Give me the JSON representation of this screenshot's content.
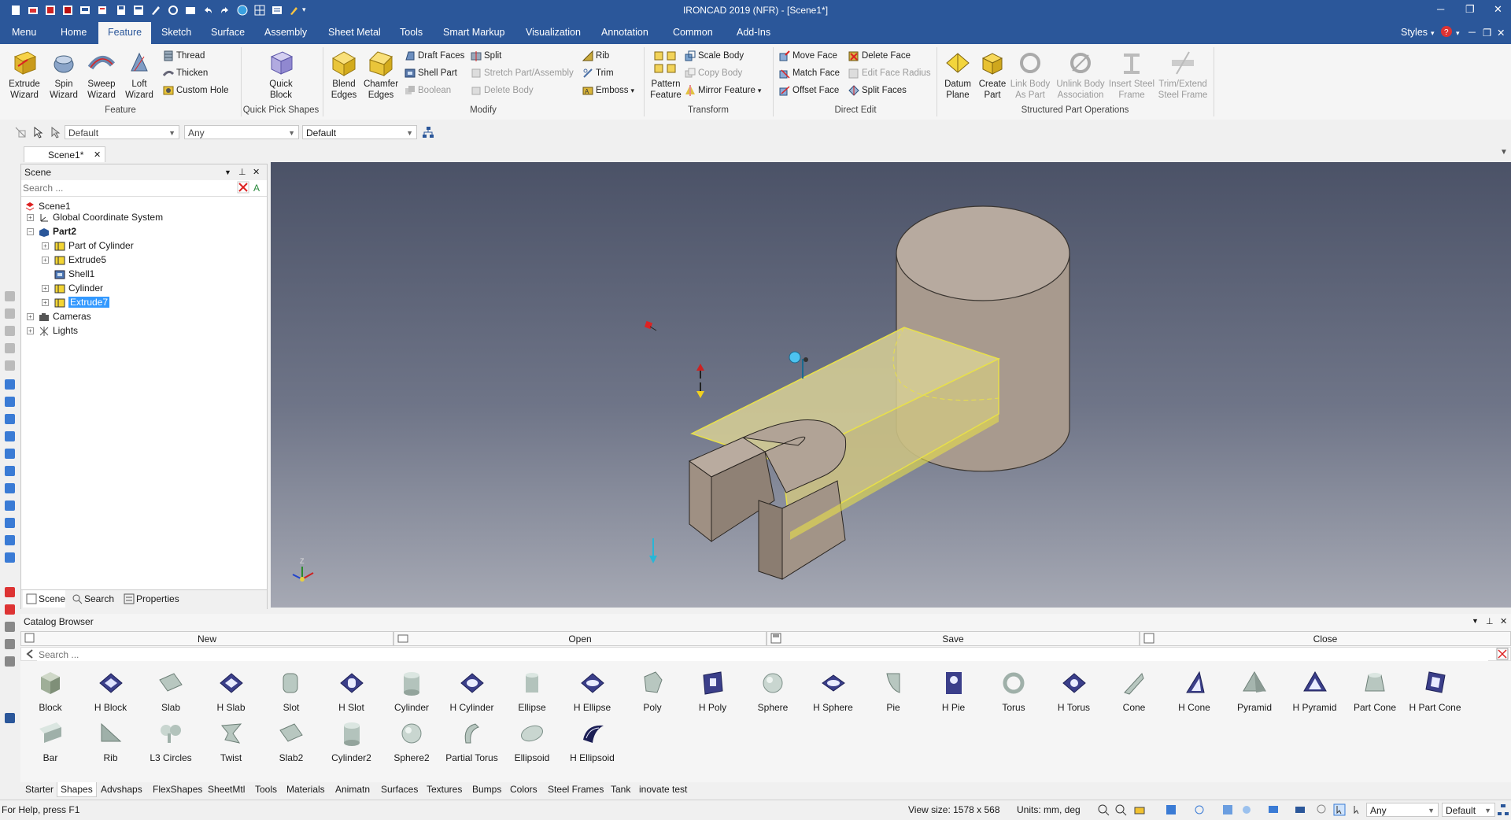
{
  "app": {
    "title": "IRONCAD 2019 (NFR) - [Scene1*]",
    "styles_label": "Styles",
    "window_controls": [
      "minimize-icon",
      "restore-icon",
      "close-icon"
    ]
  },
  "menu_tabs": [
    {
      "label": "Menu",
      "active": false
    },
    {
      "label": "Home",
      "active": false
    },
    {
      "label": "Feature",
      "active": true
    },
    {
      "label": "Sketch",
      "active": false
    },
    {
      "label": "Surface",
      "active": false
    },
    {
      "label": "Assembly",
      "active": false
    },
    {
      "label": "Sheet Metal",
      "active": false
    },
    {
      "label": "Tools",
      "active": false
    },
    {
      "label": "Smart Markup",
      "active": false
    },
    {
      "label": "Visualization",
      "active": false
    },
    {
      "label": "Annotation",
      "active": false
    },
    {
      "label": "Common",
      "active": false
    },
    {
      "label": "Add-Ins",
      "active": false
    }
  ],
  "ribbon": {
    "feature": {
      "group_label": "Feature",
      "extrude": "Extrude Wizard",
      "spin": "Spin Wizard",
      "sweep": "Sweep Wizard",
      "loft": "Loft Wizard",
      "thread": "Thread",
      "thicken": "Thicken",
      "custom_hole": "Custom Hole"
    },
    "quick_pick": {
      "group_label": "Quick Pick Shapes",
      "quick_block": "Quick Block"
    },
    "modify": {
      "group_label": "Modify",
      "blend_edges": "Blend Edges",
      "chamfer_edges": "Chamfer Edges",
      "draft_faces": "Draft Faces",
      "shell_part": "Shell Part",
      "boolean": "Boolean",
      "split": "Split",
      "stretch": "Stretch Part/Assembly",
      "delete_body": "Delete Body",
      "rib": "Rib",
      "trim": "Trim",
      "emboss": "Emboss"
    },
    "transform": {
      "group_label": "Transform",
      "pattern": "Pattern Feature",
      "scale_body": "Scale Body",
      "copy_body": "Copy Body",
      "mirror": "Mirror Feature"
    },
    "direct_edit": {
      "group_label": "Direct Edit",
      "move_face": "Move Face",
      "match_face": "Match Face",
      "offset_face": "Offset Face",
      "delete_face": "Delete Face",
      "edit_face_radius": "Edit Face Radius",
      "split_faces": "Split Faces"
    },
    "structured": {
      "group_label": "Structured Part Operations",
      "datum_plane": "Datum Plane",
      "create_part": "Create Part",
      "link_body": "Link Body As Part",
      "unlink_body": "Unlink Body Association",
      "insert_steel": "Insert Steel Frame",
      "trim_extend": "Trim/Extend Steel Frame"
    }
  },
  "toolbar2": {
    "combo1": "Default",
    "combo2": "Any",
    "combo3": "Default"
  },
  "doc_tab": {
    "label": "Scene1*"
  },
  "scene_panel": {
    "title": "Scene",
    "search_placeholder": "Search ...",
    "tree": {
      "scene1": "Scene1",
      "gcs": "Global Coordinate System",
      "part2": "Part2",
      "part_of_cylinder": "Part of Cylinder",
      "extrude5": "Extrude5",
      "shell1": "Shell1",
      "cylinder": "Cylinder",
      "extrude7": "Extrude7",
      "cameras": "Cameras",
      "lights": "Lights"
    },
    "bottom_tabs": {
      "scene": "Scene",
      "search": "Search",
      "properties": "Properties"
    }
  },
  "viewport": {
    "axis_label": "Z"
  },
  "catalog": {
    "title": "Catalog Browser",
    "buttons": {
      "new": "New",
      "open": "Open",
      "save": "Save",
      "close": "Close"
    },
    "search_placeholder": "Search ...",
    "items": [
      "Block",
      "H Block",
      "Slab",
      "H Slab",
      "Slot",
      "H Slot",
      "Cylinder",
      "H Cylinder",
      "Ellipse",
      "H Ellipse",
      "Poly",
      "H Poly",
      "Sphere",
      "H Sphere",
      "Pie",
      "H Pie",
      "Torus",
      "H Torus",
      "Cone",
      "H Cone",
      "Pyramid",
      "H Pyramid",
      "Part Cone",
      "H Part Cone",
      "Bar",
      "Rib",
      "L3 Circles",
      "Twist",
      "Slab2",
      "Cylinder2",
      "Sphere2",
      "Partial Torus",
      "Ellipsoid",
      "H Ellipsoid"
    ],
    "tabs": [
      {
        "label": "Starter",
        "active": false
      },
      {
        "label": "Shapes",
        "active": true
      },
      {
        "label": "Advshaps",
        "active": false
      },
      {
        "label": "FlexShapes",
        "active": false
      },
      {
        "label": "SheetMtl",
        "active": false
      },
      {
        "label": "Tools",
        "active": false
      },
      {
        "label": "Materials",
        "active": false
      },
      {
        "label": "Animatn",
        "active": false
      },
      {
        "label": "Surfaces",
        "active": false
      },
      {
        "label": "Textures",
        "active": false
      },
      {
        "label": "Bumps",
        "active": false
      },
      {
        "label": "Colors",
        "active": false
      },
      {
        "label": "Steel Frames",
        "active": false
      },
      {
        "label": "Tank",
        "active": false
      },
      {
        "label": "inovate test",
        "active": false
      }
    ]
  },
  "status": {
    "help": "For Help, press F1",
    "view_size": "View size: 1578 x   568",
    "units": "Units: mm, deg",
    "combo1": "Any",
    "combo2": "Default"
  }
}
